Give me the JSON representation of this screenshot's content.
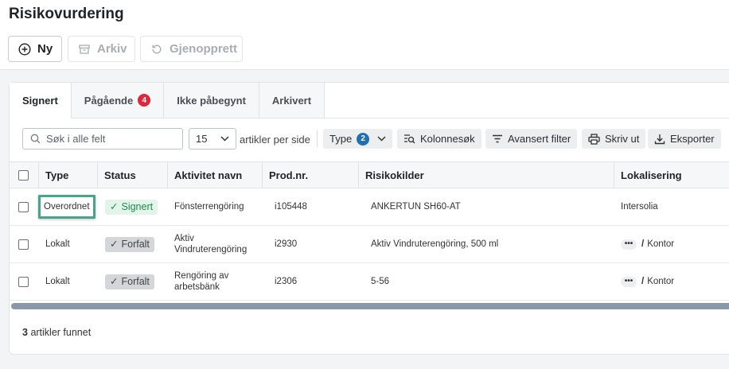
{
  "page": {
    "title": "Risikovurdering"
  },
  "toolbar": {
    "new_label": "Ny",
    "archive_label": "Arkiv",
    "restore_label": "Gjenopprett"
  },
  "tabs": [
    {
      "label": "Signert",
      "active": true
    },
    {
      "label": "Pågående",
      "badge": "4"
    },
    {
      "label": "Ikke påbegynt"
    },
    {
      "label": "Arkivert"
    }
  ],
  "filters": {
    "search_placeholder": "Søk i alle felt",
    "per_page_value": "15",
    "per_page_label": "artikler per side",
    "type_label": "Type",
    "type_count": "2",
    "column_search_label": "Kolonnesøk",
    "advanced_filter_label": "Avansert filter",
    "print_label": "Skriv ut",
    "export_label": "Eksporter"
  },
  "table": {
    "columns": [
      "Type",
      "Status",
      "Aktivitet navn",
      "Prod.nr.",
      "Risikokilder",
      "Lokalisering"
    ],
    "rows": [
      {
        "type": "Overordnet",
        "status": "Signert",
        "activity": "Fönsterrengöring",
        "prod_nr": "i105448",
        "sources": "ANKERTUN SH60-AT",
        "location": "Intersolia"
      },
      {
        "type": "Lokalt",
        "status": "Forfalt",
        "activity": "Aktiv Vindruterengöring",
        "prod_nr": "i2930",
        "sources": "Aktiv Vindruterengöring, 500 ml",
        "location": "Kontor",
        "location_prefix": "•••",
        "location_sep": "/"
      },
      {
        "type": "Lokalt",
        "status": "Forfalt",
        "activity": "Rengöring av arbetsbänk",
        "prod_nr": "i2306",
        "sources": "5-56",
        "location": "Kontor",
        "location_prefix": "•••",
        "location_sep": "/"
      }
    ]
  },
  "footer": {
    "count": "3",
    "label": "artikler funnet"
  },
  "colors": {
    "accent_blue": "#1f6fb2",
    "badge_red": "#e0263a",
    "signed_green": "#1f8a4c",
    "highlight_teal": "#4aa38b"
  }
}
